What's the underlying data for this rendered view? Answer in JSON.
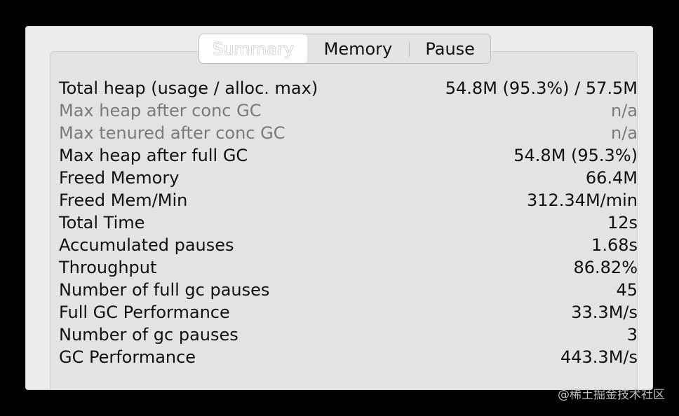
{
  "tabs": [
    {
      "label": "Summary",
      "selected": true
    },
    {
      "label": "Memory",
      "selected": false
    },
    {
      "label": "Pause",
      "selected": false
    }
  ],
  "rows": [
    {
      "label": "Total heap (usage / alloc. max)",
      "value": "54.8M (95.3%) / 57.5M",
      "dimmed": false
    },
    {
      "label": "Max heap after conc GC",
      "value": "n/a",
      "dimmed": true
    },
    {
      "label": "Max tenured after conc GC",
      "value": "n/a",
      "dimmed": true
    },
    {
      "label": "Max heap after full GC",
      "value": "54.8M (95.3%)",
      "dimmed": false
    },
    {
      "label": "Freed Memory",
      "value": "66.4M",
      "dimmed": false
    },
    {
      "label": "Freed Mem/Min",
      "value": "312.34M/min",
      "dimmed": false
    },
    {
      "label": "Total Time",
      "value": "12s",
      "dimmed": false
    },
    {
      "label": "Accumulated pauses",
      "value": "1.68s",
      "dimmed": false
    },
    {
      "label": "Throughput",
      "value": "86.82%",
      "dimmed": false
    },
    {
      "label": "Number of full gc pauses",
      "value": "45",
      "dimmed": false
    },
    {
      "label": "Full GC Performance",
      "value": "33.3M/s",
      "dimmed": false
    },
    {
      "label": "Number of gc pauses",
      "value": "3",
      "dimmed": false
    },
    {
      "label": "GC Performance",
      "value": "443.3M/s",
      "dimmed": false
    }
  ],
  "watermark": "@稀土掘金技术社区"
}
